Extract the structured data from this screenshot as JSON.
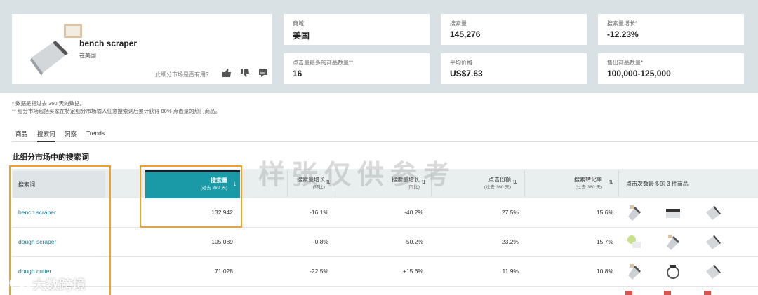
{
  "product": {
    "name": "bench scraper",
    "location": "在美国",
    "feedback_question": "此细分市场是否有用?"
  },
  "stats": [
    {
      "label": "商城",
      "value": "美国"
    },
    {
      "label": "搜索量",
      "value": "145,276"
    },
    {
      "label": "搜索量增长*",
      "value": "-12.23%"
    },
    {
      "label": "点击量最多的商品数量**",
      "value": "16"
    },
    {
      "label": "平均价格",
      "value": "US$7.63"
    },
    {
      "label": "售出商品数量*",
      "value": "100,000-125,000"
    }
  ],
  "notes": [
    "* 数据是指过去 360 天的数据。",
    "** 细分市场包括买家在特定细分市场输入任意搜索词后累计获得 80% 点击量的热门商品。"
  ],
  "tabs": [
    "商品",
    "搜索词",
    "洞察",
    "Trends"
  ],
  "active_tab": "搜索词",
  "section_title": "此细分市场中的搜索词",
  "table": {
    "headers": {
      "keyword": "搜索词",
      "search_volume": "搜索量",
      "search_volume_sub": "(过去 360 天)",
      "growth": "搜索量增长",
      "growth_sub": "(环比)",
      "growth_yoy": "搜索量增长",
      "growth_yoy_sub": "(同比)",
      "click_share": "点击份额",
      "click_share_sub": "(过去 360 天)",
      "conversion": "搜索转化率",
      "conversion_sub": "(过去 360 天)",
      "top_products": "点击次数最多的 3 件商品"
    },
    "rows": [
      {
        "keyword": "bench scraper",
        "volume": "132,942",
        "growth": "-16.1%",
        "growth_yoy": "-40.2%",
        "click_share": "27.5%",
        "conversion": "15.6%"
      },
      {
        "keyword": "dough scraper",
        "volume": "105,089",
        "growth": "-0.8%",
        "growth_yoy": "-50.2%",
        "click_share": "23.2%",
        "conversion": "15.7%"
      },
      {
        "keyword": "dough cutter",
        "volume": "71,028",
        "growth": "-22.5%",
        "growth_yoy": "+15.6%",
        "click_share": "11.9%",
        "conversion": "10.8%"
      }
    ]
  },
  "watermark": "样张仅供参考",
  "brand_watermark": "大数跨境",
  "colors": {
    "accent": "#1a9aa7",
    "highlight": "#f2a126",
    "link": "#1a7f95"
  },
  "icons": [
    "thumbs-up-icon",
    "thumbs-down-icon",
    "comment-icon",
    "sort-arrows-icon",
    "sort-down-icon"
  ]
}
